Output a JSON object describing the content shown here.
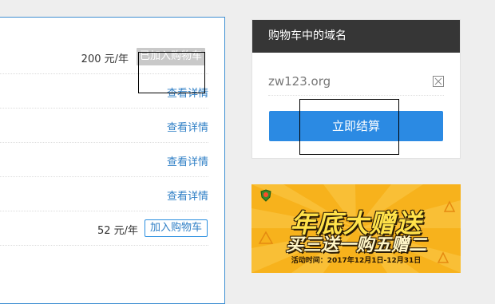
{
  "results": {
    "rows": [
      {
        "price": "200 元/年",
        "action": "已加入购物车",
        "state": "added"
      },
      {
        "action": "查看详情",
        "state": "details"
      },
      {
        "action": "查看详情",
        "state": "details"
      },
      {
        "action": "查看详情",
        "state": "details"
      },
      {
        "action": "查看详情",
        "state": "details"
      },
      {
        "price": "52 元/年",
        "action": "加入购物车",
        "state": "add"
      }
    ]
  },
  "cart": {
    "title": "购物车中的域名",
    "item": "zw123.org",
    "remove_icon": "close-box-icon",
    "checkout_label": "立即结算"
  },
  "banner": {
    "line1": "年底大赠送",
    "line2": "买三送一购五赠二",
    "date": "活动时间：2017年12月1日-12月31日",
    "colors": {
      "background": "#f7b21c",
      "title": "#ffe24a"
    }
  }
}
